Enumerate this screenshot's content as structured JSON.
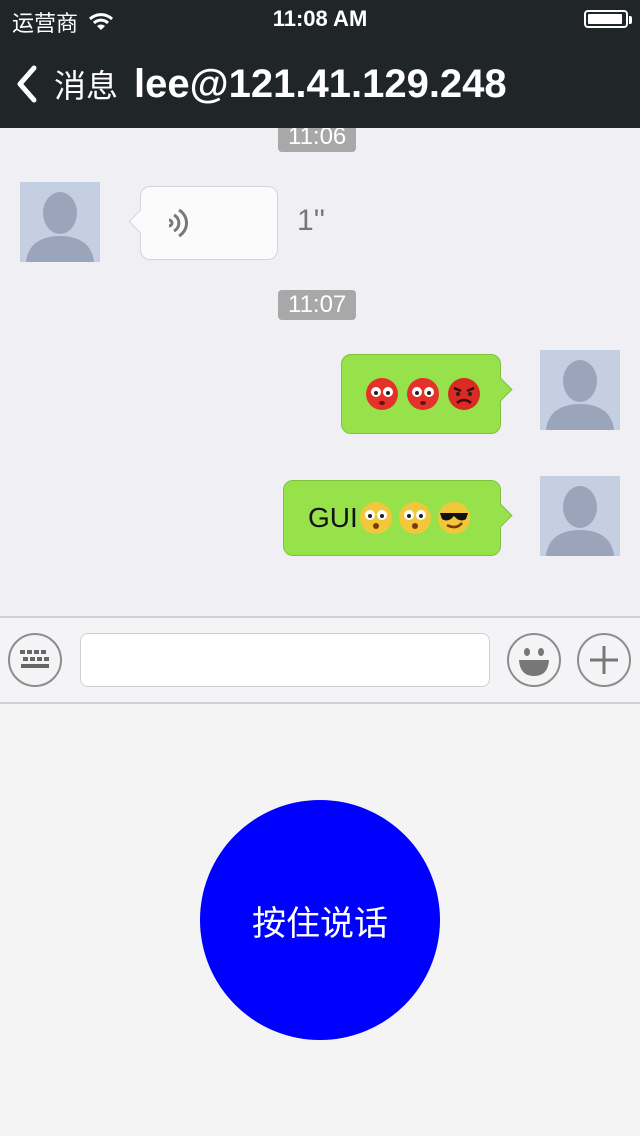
{
  "status_bar": {
    "carrier": "运营商",
    "time": "11:08 AM"
  },
  "nav": {
    "back_label": "消息",
    "title": "lee@121.41.129.248"
  },
  "messages": {
    "timestamp_1": "11:06",
    "voice_duration": "1''",
    "timestamp_2": "11:07",
    "text_message": "GUI"
  },
  "input_bar": {
    "placeholder": ""
  },
  "talk_button": {
    "label": "按住说话"
  },
  "colors": {
    "nav_bg": "#202528",
    "bubble_out": "#97e14b",
    "talk_button": "#0000ff",
    "chat_bg": "#efeff4"
  }
}
